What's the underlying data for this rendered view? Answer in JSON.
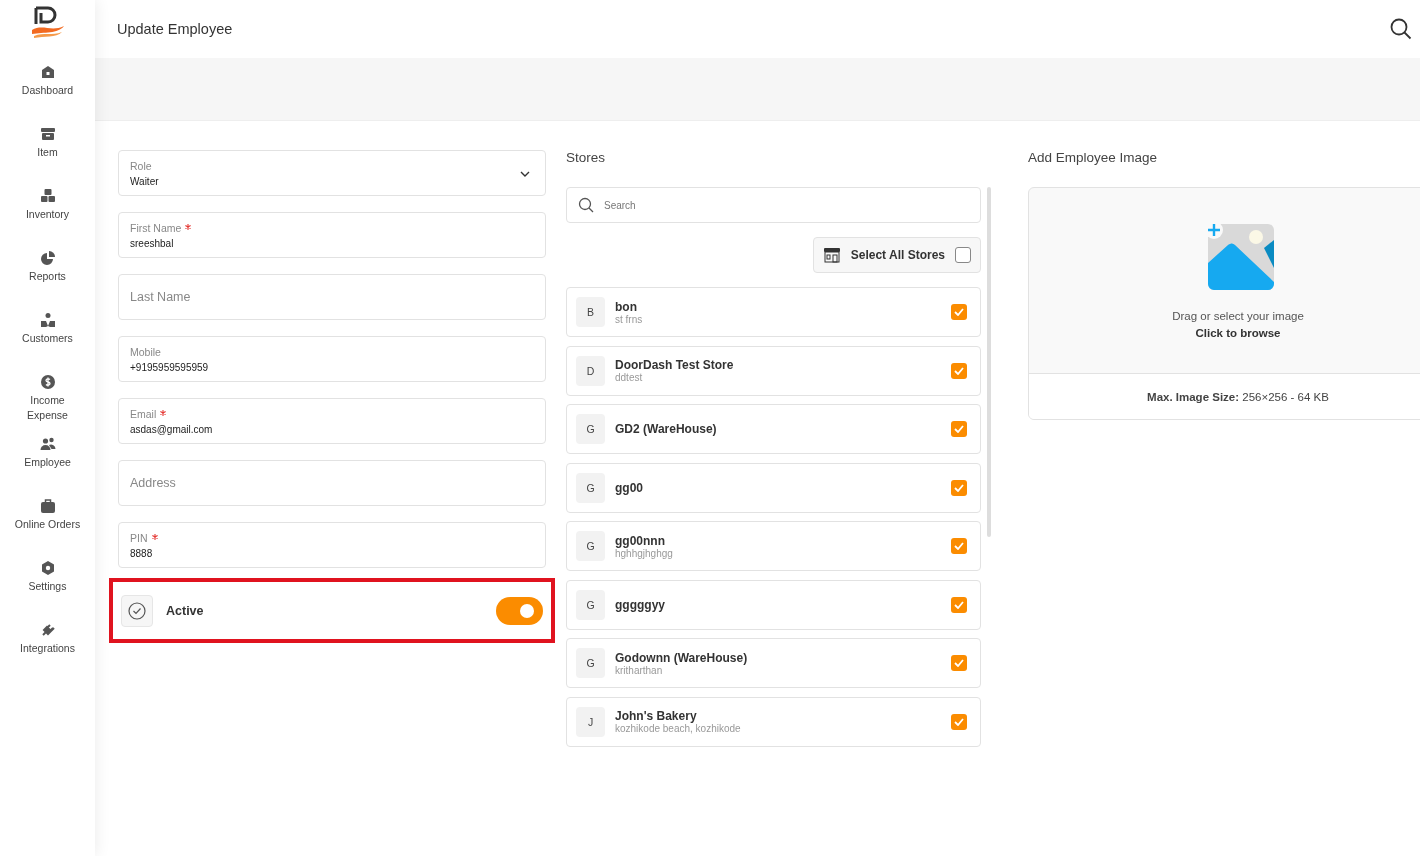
{
  "header": {
    "title": "Update Employee"
  },
  "sidebar": {
    "items": [
      {
        "label": "Dashboard",
        "kind": "home"
      },
      {
        "label": "Item",
        "kind": "box"
      },
      {
        "label": "Inventory",
        "kind": "boxes"
      },
      {
        "label": "Reports",
        "kind": "pie"
      },
      {
        "label": "Customers",
        "kind": "user"
      },
      {
        "label": "Income Expense",
        "kind": "dollar"
      },
      {
        "label": "Employee",
        "kind": "users"
      },
      {
        "label": "Online Orders",
        "kind": "bag"
      },
      {
        "label": "Settings",
        "kind": "gear"
      },
      {
        "label": "Integrations",
        "kind": "plug"
      }
    ]
  },
  "form": {
    "fields": [
      {
        "label": "Role",
        "value": "Waiter",
        "required": false,
        "kind": "select"
      },
      {
        "label": "First Name",
        "value": "sreeshbal",
        "required": true,
        "kind": "text"
      },
      {
        "placeholder": "Last Name",
        "kind": "text"
      },
      {
        "label": "Mobile",
        "value": "+9195959595959",
        "required": false,
        "kind": "text"
      },
      {
        "label": "Email",
        "value": "asdas@gmail.com",
        "required": true,
        "kind": "text"
      },
      {
        "placeholder": "Address",
        "kind": "text"
      },
      {
        "label": "PIN",
        "value": "8888",
        "required": true,
        "kind": "text"
      }
    ],
    "active": {
      "label": "Active",
      "on": true,
      "highlighted": true
    }
  },
  "stores": {
    "title": "Stores",
    "search": {
      "placeholder": "Search"
    },
    "select_all": {
      "label": "Select All Stores",
      "checked": false
    },
    "items": [
      {
        "initial": "B",
        "name": "bon",
        "subtitle": "st frns",
        "checked": true
      },
      {
        "initial": "D",
        "name": "DoorDash Test Store",
        "subtitle": "ddtest",
        "checked": true
      },
      {
        "initial": "G",
        "name": "GD2 (WareHouse)",
        "checked": true
      },
      {
        "initial": "G",
        "name": "gg00",
        "checked": true
      },
      {
        "initial": "G",
        "name": "gg00nnn",
        "subtitle": "hghhgjhghgg",
        "checked": true
      },
      {
        "initial": "G",
        "name": "gggggyy",
        "checked": true
      },
      {
        "initial": "G",
        "name": "Godownn (WareHouse)",
        "subtitle": "kritharthan",
        "checked": true
      },
      {
        "initial": "J",
        "name": "John's Bakery",
        "subtitle": "kozhikode beach, kozhikode",
        "checked": true
      }
    ]
  },
  "image": {
    "title": "Add Employee Image",
    "hint": "Drag or select your image",
    "browse": "Click to browse",
    "limit": "**Max. Image Size:** 256×256 - 64 KB"
  }
}
